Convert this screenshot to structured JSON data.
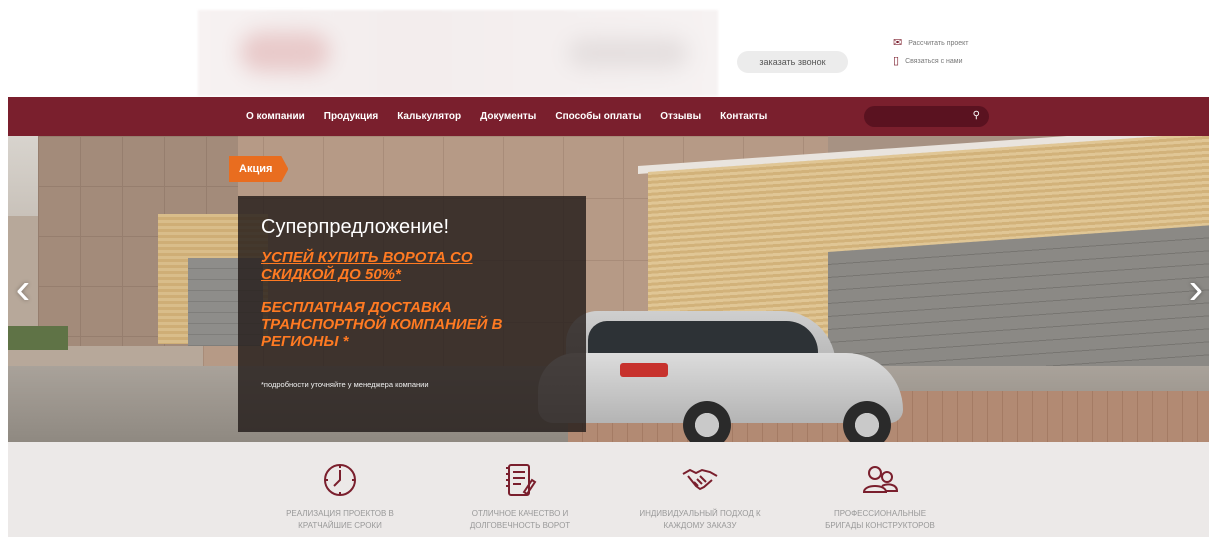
{
  "header": {
    "call_button": "заказать звонок",
    "links": [
      {
        "label": "Рассчитать проект",
        "icon": "envelope-icon"
      },
      {
        "label": "Связаться с нами",
        "icon": "phone-icon"
      }
    ]
  },
  "nav": {
    "items": [
      "О компании",
      "Продукция",
      "Калькулятор",
      "Документы",
      "Способы оплаты",
      "Отзывы",
      "Контакты"
    ],
    "search_placeholder": ""
  },
  "promo": {
    "badge": "Акция",
    "title": "Суперпредложение!",
    "line1a": "УСПЕЙ КУПИТЬ ВОРОТА СО",
    "line1b": "СКИДКОЙ ДО 50%*",
    "line2a": "БЕСПЛАТНАЯ ДОСТАВКА",
    "line2b": "ТРАНСПОРТНОЙ КОМПАНИЕЙ В",
    "line2c": "РЕГИОНЫ *",
    "note": "*подробности уточняйте у менеджера компании",
    "prev_icon": "chevron-left-icon",
    "next_icon": "chevron-right-icon"
  },
  "features": [
    {
      "icon": "clock-icon",
      "line1": "РЕАЛИЗАЦИЯ ПРОЕКТОВ В",
      "line2": "КРАТЧАЙШИЕ СРОКИ"
    },
    {
      "icon": "document-icon",
      "line1": "ОТЛИЧНОЕ КАЧЕСТВО И",
      "line2": "ДОЛГОВЕЧНОСТЬ ВОРОТ"
    },
    {
      "icon": "handshake-icon",
      "line1": "ИНДИВИДУАЛЬНЫЙ ПОДХОД К",
      "line2": "КАЖДОМУ ЗАКАЗУ"
    },
    {
      "icon": "team-icon",
      "line1": "ПРОФЕССИОНАЛЬНЫЕ",
      "line2": "БРИГАДЫ КОНСТРУКТОРОВ"
    }
  ],
  "colors": {
    "brand": "#7a1f2d",
    "accent": "#e96d1f",
    "promo_text": "#ff7a22",
    "features_bg": "#ece9e8"
  }
}
